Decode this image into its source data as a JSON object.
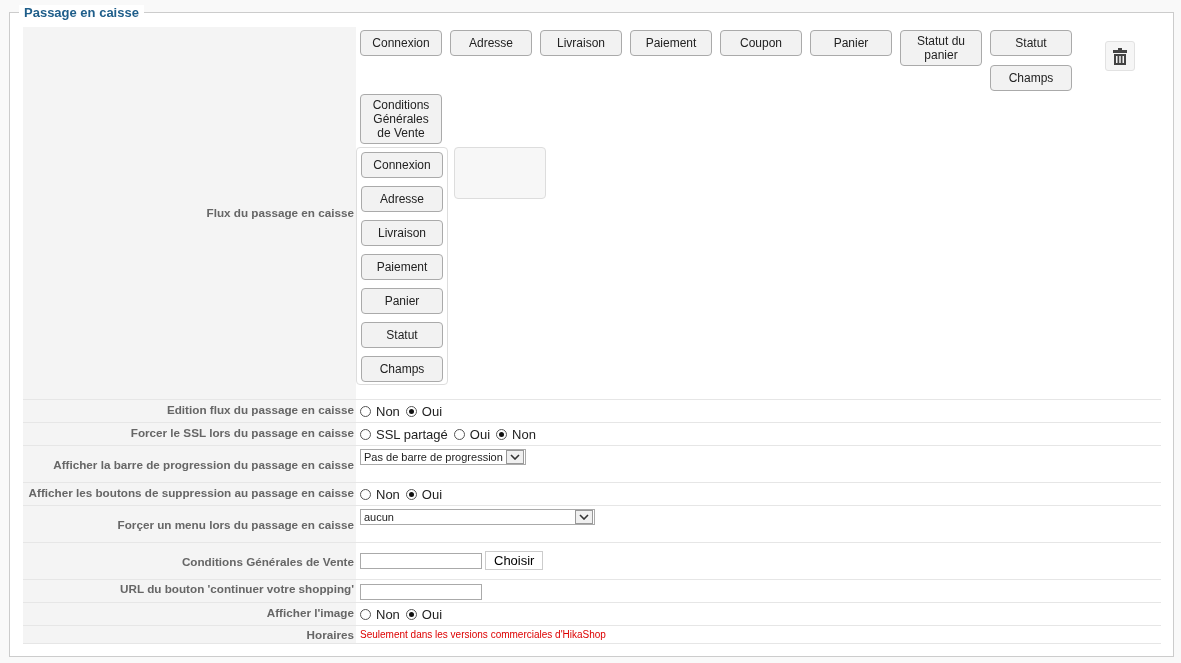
{
  "section": {
    "title": "Passage en caisse"
  },
  "flow": {
    "label": "Flux du passage en caisse",
    "available": [
      [
        "Connexion"
      ],
      [
        "Adresse"
      ],
      [
        "Livraison"
      ],
      [
        "Paiement"
      ],
      [
        "Coupon"
      ],
      [
        "Panier"
      ],
      [
        "Statut du panier"
      ],
      [
        "Statut",
        "Champs"
      ],
      [
        "Conditions Générales de Vente"
      ]
    ],
    "step": [
      "Connexion",
      "Adresse",
      "Livraison",
      "Paiement",
      "Panier",
      "Statut",
      "Champs"
    ]
  },
  "rows": [
    {
      "kind": "radio",
      "label": "Edition flux du passage en caisse",
      "options": [
        {
          "label": "Non",
          "selected": false
        },
        {
          "label": "Oui",
          "selected": true
        }
      ]
    },
    {
      "kind": "radio",
      "label": "Forcer le SSL lors du passage en caisse",
      "options": [
        {
          "label": "SSL partagé",
          "selected": false
        },
        {
          "label": "Oui",
          "selected": false
        },
        {
          "label": "Non",
          "selected": true
        }
      ]
    },
    {
      "kind": "select",
      "label": "Afficher la barre de progression du passage en caisse",
      "value": "Pas de barre de progression",
      "wide": false
    },
    {
      "kind": "radio",
      "label": "Afficher les boutons de suppression au passage en caisse",
      "options": [
        {
          "label": "Non",
          "selected": false
        },
        {
          "label": "Oui",
          "selected": true
        }
      ]
    },
    {
      "kind": "select",
      "label": "Forçer un menu lors du passage en caisse",
      "value": "aucun",
      "wide": true
    },
    {
      "kind": "text_button",
      "label": "Conditions Générales de Vente",
      "button": "Choisir"
    },
    {
      "kind": "text",
      "label": "URL du bouton 'continuer votre shopping'"
    },
    {
      "kind": "radio",
      "label": "Afficher l'image",
      "options": [
        {
          "label": "Non",
          "selected": false
        },
        {
          "label": "Oui",
          "selected": true
        }
      ]
    },
    {
      "kind": "note",
      "label": "Horaires",
      "note": "Seulement dans les versions commerciales d'HikaShop"
    }
  ]
}
